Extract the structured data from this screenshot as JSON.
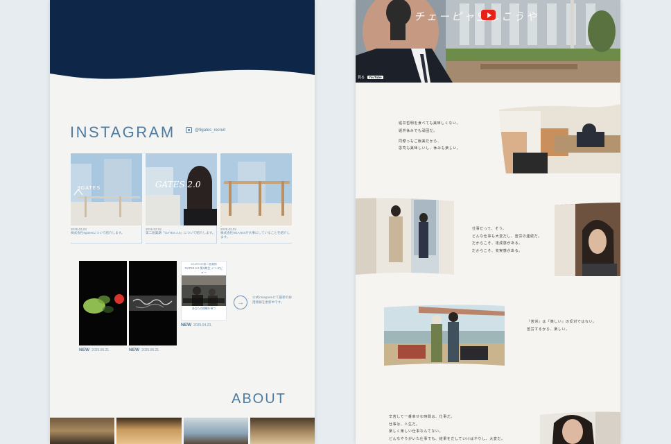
{
  "left": {
    "instagram_title": "INSTAGRAM",
    "instagram_handle": "@9gates_recruit",
    "posts": [
      {
        "date": "2025.03.03",
        "caption": "株式会社9gatesについて紹介します。",
        "thumb_text": "9GATES"
      },
      {
        "date": "2025.02.02",
        "caption": "第二創業期「GATES 2.0」について紹介します。",
        "thumb_text": "GATES 2.0"
      },
      {
        "date": "2025.02.02",
        "caption": "株式会社9GATESが大事にしていることを紹介します。",
        "thumb_text": ""
      }
    ],
    "reels": [
      {
        "badge": "NEW",
        "date": "2025.05.21."
      },
      {
        "badge": "NEW",
        "date": "2025.05.21."
      },
      {
        "badge": "NEW",
        "date": "2025.04.23."
      }
    ],
    "reel3_heading": "GATES 2.0 第1期生 インタビュー",
    "reel3_sub": "9GATESの第二創業期",
    "reel3_footer": "あなたの挑戦を待つ",
    "follow_text": "公式instagramにて最新の採用情報を更新中です。",
    "about_title": "ABOUT",
    "colors": {
      "navy": "#0e2748",
      "accent": "#4d7aa0",
      "muted": "#6a8fb0"
    },
    "icons": [
      "instagram-icon",
      "arrow-right-icon"
    ]
  },
  "right": {
    "video_title": "チェーピャ空しこうや",
    "video_label_prefix": "見る",
    "video_label_brand": "YouTube",
    "block1": [
      "堀井哲明を食べても美味しくない。",
      "堀井休みでも頑固だ。",
      "同僚っもご飯美だから、",
      "思司も美味しいし、休みも楽しい。"
    ],
    "block2": [
      "仕事だって、そう。",
      "どんな仕事も大変だし、苦労の連続だ。",
      "だからこそ、達成感がある。",
      "だからこそ、充実感がある。"
    ],
    "block3": [
      "『苦労』は『楽しい』の反対ではない。",
      "苦労するから、楽しい。"
    ],
    "block4": [
      "辛苦して一番幸せな時間は、仕事だ。",
      "仕事は、人生だ。",
      "楽しく楽しい仕事なんてない。",
      "どんなやりがいた仕事でも、結果をだしていけばやりし、大変だ。"
    ],
    "colors": {
      "youtube_red": "#e62117"
    },
    "icons": [
      "youtube-play-icon"
    ]
  }
}
